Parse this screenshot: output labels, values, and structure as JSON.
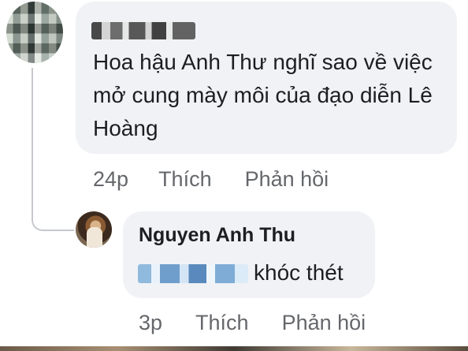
{
  "comment": {
    "author_name_blurred": "",
    "text": "Hoa hậu Anh Thư nghĩ sao về việc mở cung mày môi của đạo diễn Lê Hoàng",
    "time": "24p",
    "like_label": "Thích",
    "reply_label": "Phản hồi"
  },
  "reply": {
    "author_name": "Nguyen Anh Thu",
    "mention_blurred": "",
    "text": "khóc thét",
    "time": "3p",
    "like_label": "Thích",
    "reply_label": "Phản hồi"
  },
  "colors": {
    "bubble_bg": "#f0f2f5",
    "meta_text": "#65676b",
    "mention_blue": "#3f78b3"
  }
}
